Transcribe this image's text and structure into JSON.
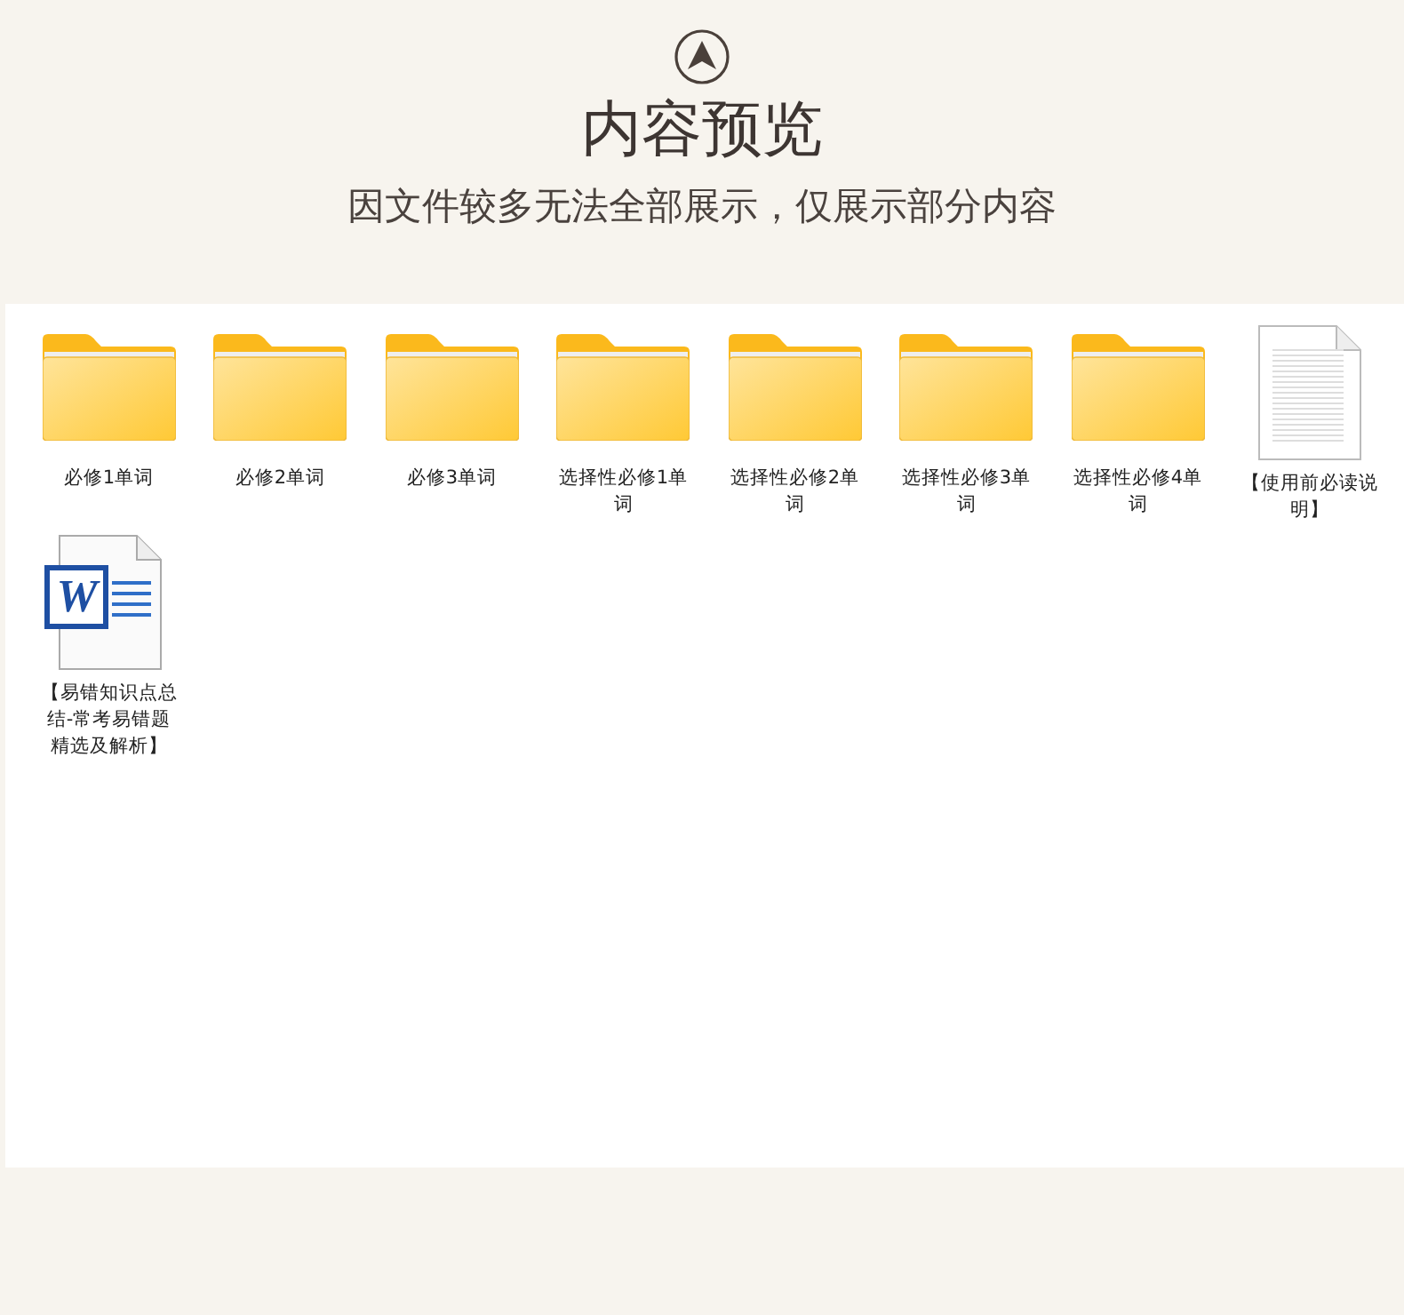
{
  "header": {
    "title": "内容预览",
    "subtitle": "因文件较多无法全部展示，仅展示部分内容"
  },
  "files": [
    {
      "kind": "folder",
      "name": "必修1单词"
    },
    {
      "kind": "folder",
      "name": "必修2单词"
    },
    {
      "kind": "folder",
      "name": "必修3单词"
    },
    {
      "kind": "folder",
      "name": "选择性必修1单词"
    },
    {
      "kind": "folder",
      "name": "选择性必修2单词"
    },
    {
      "kind": "folder",
      "name": "选择性必修3单词"
    },
    {
      "kind": "folder",
      "name": "选择性必修4单词"
    },
    {
      "kind": "text",
      "name": "【使用前必读说明】"
    },
    {
      "kind": "word",
      "name": "【易错知识点总结-常考易错题精选及解析】",
      "icon_letter": "W"
    }
  ]
}
